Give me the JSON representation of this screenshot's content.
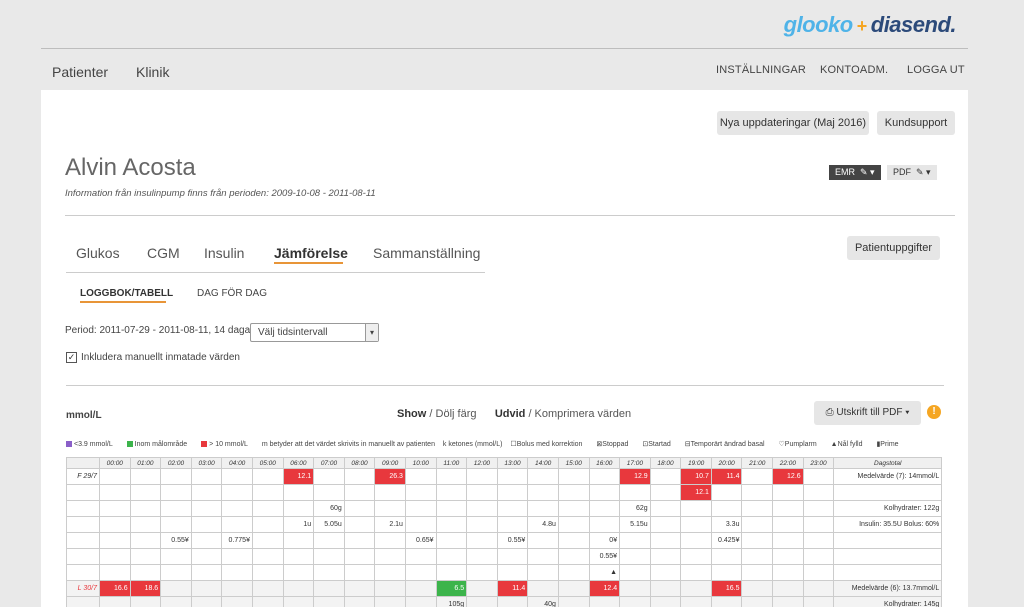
{
  "brand": {
    "part1": "glooko",
    "plus": "+",
    "part2": "diasend."
  },
  "nav": {
    "left": [
      "Patienter",
      "Klinik"
    ],
    "right": [
      "INSTÄLLNINGAR",
      "KONTOADM.",
      "LOGGA UT"
    ]
  },
  "buttons": {
    "updates": "Nya uppdateringar (Maj 2016)",
    "support": "Kundsupport",
    "emr": "EMR",
    "pdf": "PDF",
    "patient_info": "Patientuppgifter"
  },
  "patient": {
    "name": "Alvin Acosta",
    "info": "Information från insulinpump finns från perioden: 2009-10-08 - 2011-08-11"
  },
  "tabs": [
    "Glukos",
    "CGM",
    "Insulin",
    "Jämförelse",
    "Sammanställning"
  ],
  "subtabs": [
    "LOGGBOK/TABELL",
    "DAG FÖR DAG"
  ],
  "period": {
    "text": "Period: 2011-07-29 - 2011-08-11, 14 dagar",
    "select": "Välj tidsintervall"
  },
  "include_manual": "Inkludera manuellt inmatade värden",
  "unit": "mmol/L",
  "view": {
    "show": "Show",
    "hide": " / Dölj färg",
    "expand": "Udvid",
    "compress": " / Komprimera värden"
  },
  "print": "Utskrift till PDF",
  "legend": {
    "low": "<3.9 mmol/L",
    "in": "Inom målområde",
    "high": "> 10 mmol/L",
    "manual": "m betyder att det värdet skrivits in manuellt av patienten",
    "ketones": "k ketones (mmol/L)",
    "bolus": "Bolus med korrektion",
    "stopped": "Stoppad",
    "started": "Startad",
    "temp": "Temporärt ändrad basal",
    "alarm": "Pumplarm",
    "fill": "Nål fylld",
    "prime": "Prime"
  },
  "colors": {
    "low": "#8a5fc8",
    "in": "#3cb44b",
    "high": "#e8383d",
    "accent": "#e89538"
  },
  "table": {
    "hours": [
      "00:00",
      "01:00",
      "02:00",
      "03:00",
      "04:00",
      "05:00",
      "06:00",
      "07:00",
      "08:00",
      "09:00",
      "10:00",
      "11:00",
      "12:00",
      "13:00",
      "14:00",
      "15:00",
      "16:00",
      "17:00",
      "18:00",
      "19:00",
      "20:00",
      "21:00",
      "22:00",
      "23:00"
    ],
    "total_header": "Dagstotal",
    "days": [
      {
        "label": "F 29/7",
        "rows": [
          {
            "cells": {
              "6": [
                "12.1",
                "red"
              ],
              "9": [
                "26.3",
                "red"
              ],
              "17": [
                "12.9",
                "red"
              ],
              "19": [
                "10.7",
                "red"
              ],
              "20": [
                "11.4",
                "red"
              ],
              "22": [
                "12.6",
                "red"
              ]
            },
            "total": "Medelvärde (7): 14mmol/L"
          },
          {
            "cells": {
              "19": [
                "12.1",
                "red"
              ]
            },
            "total": ""
          },
          {
            "cells": {
              "7": [
                "60g",
                ""
              ],
              "17": [
                "62g",
                ""
              ]
            },
            "total": "Kolhydrater: 122g"
          },
          {
            "cells": {
              "6": [
                "1u",
                ""
              ],
              "7": [
                "5.05u",
                ""
              ],
              "9": [
                "2.1u",
                ""
              ],
              "14": [
                "4.8u",
                ""
              ],
              "17": [
                "5.15u",
                ""
              ],
              "20": [
                "3.3u",
                ""
              ]
            },
            "total": "Insulin: 35.5U Bolus: 60%"
          },
          {
            "cells": {
              "2": [
                "0.55¥",
                ""
              ],
              "4": [
                "0.775¥",
                ""
              ],
              "10": [
                "0.65¥",
                ""
              ],
              "13": [
                "0.55¥",
                ""
              ],
              "16": [
                "0¥",
                ""
              ],
              "20": [
                "0.425¥",
                ""
              ]
            },
            "total": ""
          },
          {
            "cells": {
              "16": [
                "0.55¥",
                ""
              ]
            },
            "total": ""
          },
          {
            "cells": {
              "16": [
                "▲",
                ""
              ]
            },
            "total": ""
          }
        ]
      },
      {
        "label": "L 30/7",
        "rows": [
          {
            "cells": {
              "0": [
                "16.6",
                "red"
              ],
              "1": [
                "18.6",
                "red"
              ],
              "11": [
                "6.5",
                "green"
              ],
              "13": [
                "11.4",
                "red"
              ],
              "16": [
                "12.4",
                "red"
              ],
              "20": [
                "16.5",
                "red"
              ]
            },
            "total": "Medelvärde (6): 13.7mmol/L"
          },
          {
            "cells": {
              "11": [
                "105g",
                ""
              ],
              "14": [
                "40g",
                ""
              ]
            },
            "total": "Kolhydrater: 145g"
          }
        ]
      }
    ]
  }
}
